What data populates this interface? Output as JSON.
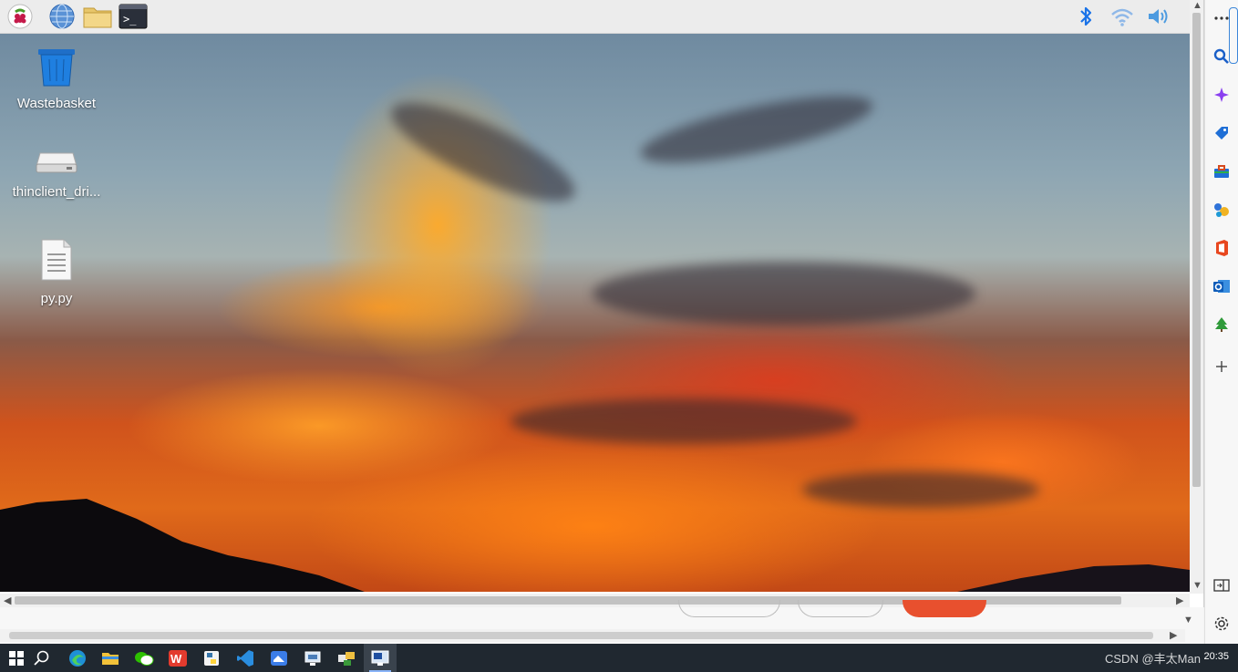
{
  "desktop": {
    "icons": [
      {
        "label": "Wastebasket"
      },
      {
        "label": "thinclient_dri..."
      },
      {
        "label": "py.py"
      }
    ]
  },
  "taskbar": {
    "clock": "20:35",
    "watermark": "CSDN @丰太Man"
  },
  "colors": {
    "panel_bg": "#ececec",
    "taskbar_bg": "#202830",
    "accent_blue": "#1a73e8"
  },
  "icons": {
    "pi_panel": [
      "raspberry-menu-icon",
      "web-browser-icon",
      "file-manager-icon",
      "terminal-icon"
    ],
    "tray": [
      "bluetooth-icon",
      "wifi-icon",
      "volume-icon"
    ],
    "edge_sidebar": [
      "more-icon",
      "search-icon",
      "copilot-icon",
      "shopping-tag-icon",
      "tools-icon",
      "games-icon",
      "office-icon",
      "outlook-icon",
      "tree-icon",
      "add-icon",
      "split-screen-icon",
      "settings-icon"
    ],
    "taskbar": [
      "windows-start-icon",
      "search-icon",
      "edge-icon",
      "explorer-icon",
      "wechat-icon",
      "wps-icon",
      "python-icon",
      "vscode-icon",
      "feishu-icon",
      "network-tool-icon",
      "remote-tool-icon",
      "remote-desktop-icon"
    ]
  }
}
